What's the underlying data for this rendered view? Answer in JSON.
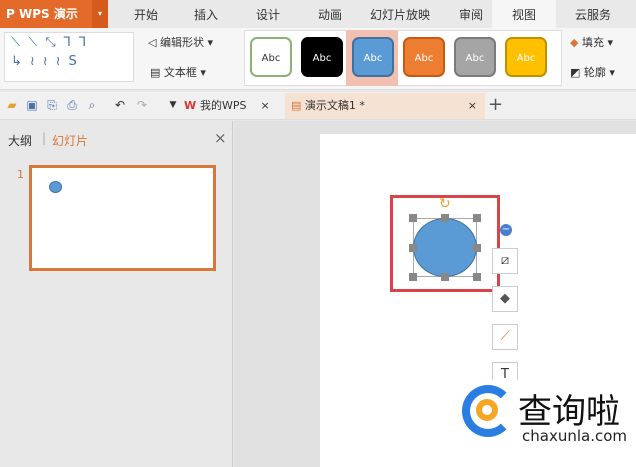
{
  "app": {
    "logo": "P WPS 演示",
    "dropdown": "▾"
  },
  "menu": [
    "开始",
    "插入",
    "设计",
    "动画",
    "幻灯片放映",
    "审阅",
    "视图",
    "云服务"
  ],
  "ribbon": {
    "edit_shape": "编辑形状 ▾",
    "textbox": "文本框 ▾",
    "fill": "填充 ▾",
    "outline": "轮廓 ▾",
    "styles": [
      {
        "label": "Abc",
        "bg": "#ffffff",
        "border": "#8bb174",
        "fg": "#333"
      },
      {
        "label": "Abc",
        "bg": "#000000",
        "border": "#000",
        "fg": "#fff"
      },
      {
        "label": "Abc",
        "bg": "#5b9bd5",
        "border": "#41719c",
        "fg": "#fff"
      },
      {
        "label": "Abc",
        "bg": "#ed7d31",
        "border": "#c55a11",
        "fg": "#fff"
      },
      {
        "label": "Abc",
        "bg": "#a5a5a5",
        "border": "#7b7b7b",
        "fg": "#fff"
      },
      {
        "label": "Abc",
        "bg": "#ffc000",
        "border": "#bf9000",
        "fg": "#fff"
      }
    ]
  },
  "doc_tabs": [
    {
      "label": "我的WPS",
      "close": "×"
    },
    {
      "label": "演示文稿1 *",
      "close": "×"
    }
  ],
  "new_tab": "+",
  "panel": {
    "tab_outline": "大纲",
    "tab_slides": "幻灯片",
    "close": "×",
    "slide_number": "1"
  },
  "watermark": {
    "brand": "查询啦",
    "url": "chaxunla.com"
  }
}
